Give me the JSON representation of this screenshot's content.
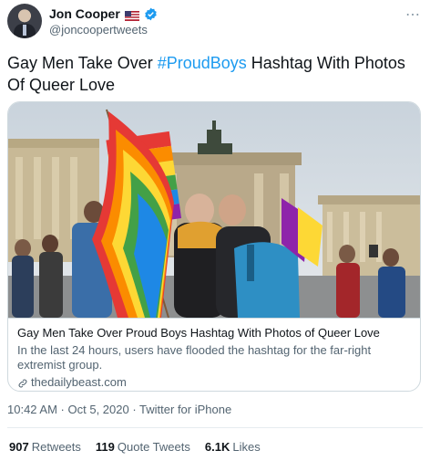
{
  "author": {
    "display_name": "Jon Cooper",
    "handle": "@joncoopertweets",
    "flag_icon": "us-flag-icon",
    "verified_icon": "verified-badge-icon"
  },
  "tweet": {
    "text_before": "Gay Men Take Over ",
    "hashtag": "#ProudBoys",
    "text_after": " Hashtag With Photos Of Queer Love"
  },
  "card": {
    "title": "Gay Men Take Over Proud Boys Hashtag With Photos of Queer Love",
    "description": "In the last 24 hours, users have flooded the hashtag for the far-right extremist group.",
    "domain": "thedailybeast.com",
    "image_alt_subject": "photo-rally-rainbow-flags"
  },
  "meta": {
    "time": "10:42 AM",
    "separator": " · ",
    "date": "Oct 5, 2020",
    "source": "Twitter for iPhone"
  },
  "stats": {
    "retweets_count": "907",
    "retweets_label": "Retweets",
    "quotes_count": "119",
    "quotes_label": "Quote Tweets",
    "likes_count": "6.1K",
    "likes_label": "Likes"
  },
  "colors": {
    "accent": "#1d9bf0",
    "text": "#0f1419",
    "secondary": "#536471",
    "border": "#cfd9de"
  }
}
